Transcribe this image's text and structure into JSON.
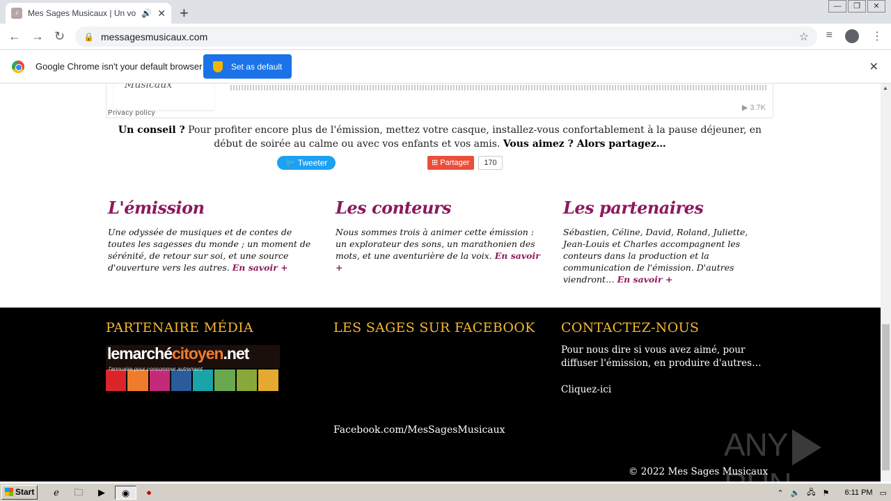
{
  "browser": {
    "tab_title": "Mes Sages Musicaux | Un voyage",
    "url": "messagesmusicaux.com",
    "infobar_text": "Google Chrome isn't your default browser",
    "default_button": "Set as default"
  },
  "player": {
    "privacy": "Privacy policy",
    "plays": "▶ 3.7K",
    "logo_text": "Musicaux"
  },
  "advice": {
    "lead": "Un conseil ?",
    "body": " Pour profiter encore plus de l'émission, mettez votre casque, installez-vous confortablement à la pause déjeuner, en début de soirée au calme ou avec vos enfants et vos amis. ",
    "tail": "Vous aimez ? Alors partagez…"
  },
  "social": {
    "tweet": "Tweeter",
    "share": "Partager",
    "share_count": "170"
  },
  "columns": [
    {
      "title": "L'émission",
      "text": "Une odyssée de musiques et de contes de toutes les sagesses du monde ; un moment de sérénité, de retour sur soi, et une source d'ouverture vers les autres. ",
      "more": "En savoir +"
    },
    {
      "title": "Les conteurs",
      "text": "Nous sommes trois à animer cette émission : un explorateur des sons, un marathonien des mots, et une aventurière de la voix. ",
      "more": "En savoir +"
    },
    {
      "title": "Les partenaires",
      "text": "Sébastien, Céline, David, Roland, Juliette, Jean-Louis et Charles accompagnent les conteurs dans la production et la communication de l'émission. D'autres viendront… ",
      "more": "En savoir +"
    }
  ],
  "footer": {
    "media_title": "PARTENAIRE MÉDIA",
    "facebook_title": "LES SAGES SUR FACEBOOK",
    "contact_title": "CONTACTEZ-NOUS",
    "contact_text": "Pour nous dire si vous avez aimé, pour diffuser l'émission, en produire d'autres…",
    "contact_link": "Cliquez-ici",
    "facebook_link": "Facebook.com/MesSagesMusicaux",
    "copyright": "© 2022 Mes Sages Musicaux",
    "logo_main": "lemarché",
    "logo_orange": "citoyen",
    "logo_tld": ".net",
    "logo_sub": "l'annuaire pour consommer autrement",
    "logo_colors": [
      "#d9252a",
      "#ef7c2c",
      "#c42a7a",
      "#2b5c99",
      "#1aa3a8",
      "#6aa84f",
      "#8aa83a",
      "#e6a92f"
    ]
  },
  "watermark": {
    "left": "ANY",
    "right": "RUN"
  },
  "taskbar": {
    "start": "Start",
    "clock": "6:11 PM"
  }
}
